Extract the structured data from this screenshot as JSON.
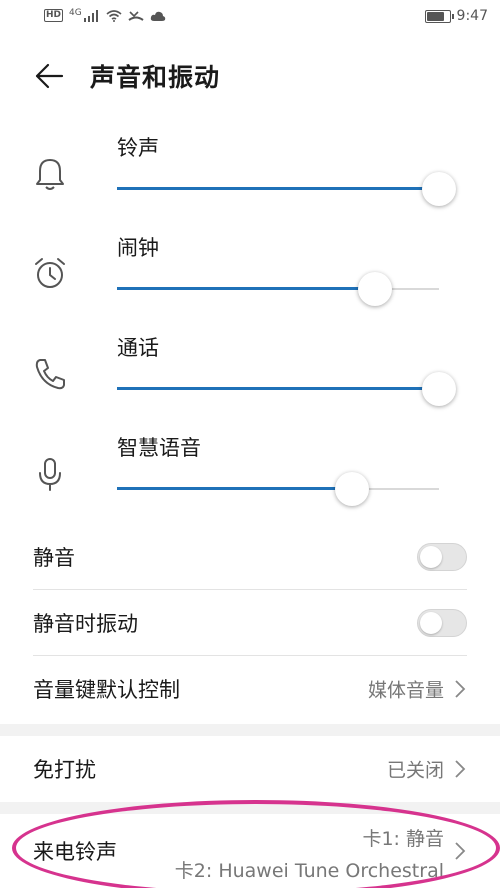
{
  "status_bar": {
    "hd": "HD",
    "net": "4G",
    "time": "9:47",
    "battery_level": 0.85,
    "icons": [
      "hd-icon",
      "signal-icon",
      "wifi-icon",
      "missed-call-icon",
      "cloud-icon",
      "battery-icon"
    ]
  },
  "header": {
    "title": "声音和振动",
    "back_icon": "arrow-left-icon"
  },
  "volumes": [
    {
      "label": "铃声",
      "icon": "bell-icon",
      "level": 1.0
    },
    {
      "label": "闹钟",
      "icon": "alarm-clock-icon",
      "level": 0.8
    },
    {
      "label": "通话",
      "icon": "phone-icon",
      "level": 1.0
    },
    {
      "label": "智慧语音",
      "icon": "microphone-icon",
      "level": 0.73
    }
  ],
  "settings": {
    "mute": {
      "label": "静音",
      "on": false
    },
    "mute_vibrate": {
      "label": "静音时振动",
      "on": false
    },
    "volume_key": {
      "label": "音量键默认控制",
      "value": "媒体音量"
    },
    "dnd": {
      "label": "免打扰",
      "value": "已关闭"
    },
    "ringtone": {
      "label": "来电铃声",
      "card1": "卡1: 静音",
      "card2": "卡2: Huawei Tune Orchestral"
    }
  },
  "colors": {
    "accent": "#1f71b8",
    "highlight": "#d6338e",
    "background": "#f2f2f2"
  }
}
